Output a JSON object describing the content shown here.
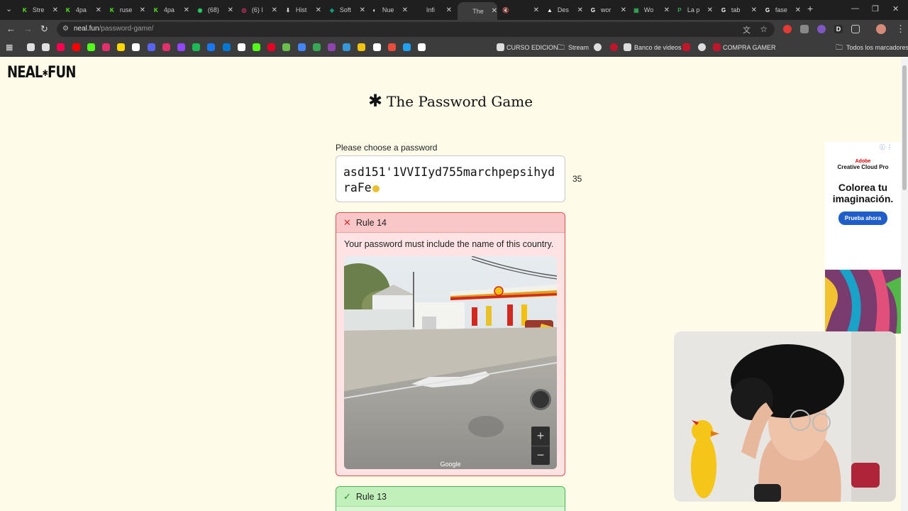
{
  "tabs": [
    {
      "title": "Stre",
      "color": "#53fc18",
      "glyph": "K"
    },
    {
      "title": "4pa",
      "color": "#53fc18",
      "glyph": "K"
    },
    {
      "title": "ruse",
      "color": "#53fc18",
      "glyph": "K"
    },
    {
      "title": "4pa",
      "color": "#53fc18",
      "glyph": "K"
    },
    {
      "title": "(68)",
      "color": "#25d366",
      "glyph": "◉"
    },
    {
      "title": "(6) I",
      "color": "#e1306c",
      "glyph": "◎"
    },
    {
      "title": "Hist",
      "color": "#cccccc",
      "glyph": "⬇"
    },
    {
      "title": "Soft",
      "color": "#10a37f",
      "glyph": "◈"
    },
    {
      "title": "Nue",
      "color": "#ffffff",
      "glyph": "◐"
    },
    {
      "title": "Infi",
      "color": "#1f1f1f",
      "glyph": " "
    },
    {
      "title": "The",
      "color": "#3c3c3c",
      "glyph": "✱",
      "active": true
    },
    {
      "title": "",
      "color": "#ffffff",
      "glyph": "🔇"
    },
    {
      "title": "Des",
      "color": "#ffffff",
      "glyph": "▲"
    },
    {
      "title": "wor",
      "color": "#ffffff",
      "glyph": "G"
    },
    {
      "title": "Wo",
      "color": "#34a853",
      "glyph": "▦"
    },
    {
      "title": "La p",
      "color": "#34a853",
      "glyph": "P"
    },
    {
      "title": "tab",
      "color": "#ffffff",
      "glyph": "G"
    },
    {
      "title": "fase",
      "color": "#ffffff",
      "glyph": "G"
    }
  ],
  "address_bar": {
    "domain": "neal.fun",
    "path": "/password-game/"
  },
  "bookmarks": {
    "curso": "CURSO EDICION",
    "stream": "Stream",
    "banco": "Banco de videos",
    "compra": "COMPRA GAMER",
    "todos": "Todos los marcadores",
    "icon_colors": [
      "#e0e0e0",
      "#e0e0e0",
      "#ff0050",
      "#ff0000",
      "#53fc18",
      "#e1306c",
      "#ffd700",
      "#ffffff",
      "#5865f2",
      "#e1306c",
      "#9146ff",
      "#1db954",
      "#1877f2",
      "#0078d4",
      "#ffffff",
      "#53fc18",
      "#e60023",
      "#6abf4b",
      "#4285f4",
      "#34a853",
      "#8e44ad",
      "#3498db",
      "#f1c40f",
      "#ffffff",
      "#e74c3c",
      "#1da1f2",
      "#ffffff"
    ]
  },
  "page": {
    "logo": "NEAL",
    "logo_suffix": "FUN",
    "title": "The Password Game",
    "prompt": "Please choose a password",
    "password": "asd151'1VVIIyd755marchpepsihydraFe",
    "char_count": "35"
  },
  "rules": {
    "active": {
      "label": "Rule 14",
      "description": "Your password must include the name of this country.",
      "map_credit": "Google"
    },
    "passed": {
      "label": "Rule 13"
    }
  },
  "ad": {
    "brand": "Adobe",
    "product": "Creative Cloud Pro",
    "headline": "Colorea tu imaginación.",
    "cta": "Prueba ahora"
  }
}
